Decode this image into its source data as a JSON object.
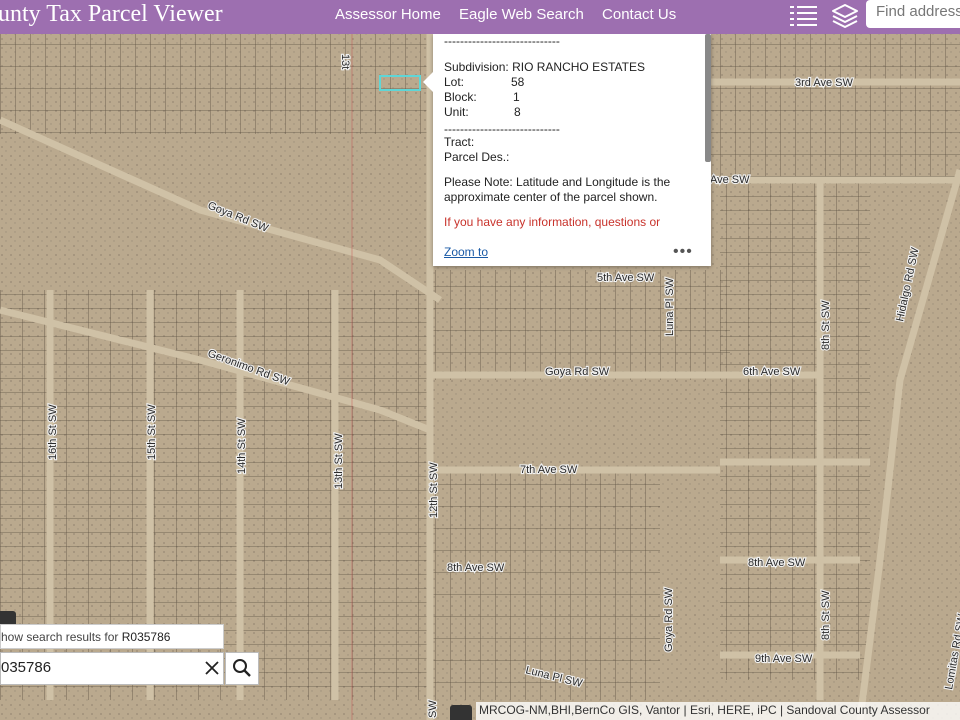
{
  "app": {
    "title": "unty Tax Parcel Viewer"
  },
  "nav": {
    "items": [
      "Assessor Home",
      "Eagle Web Search",
      "Contact Us"
    ]
  },
  "header": {
    "search_placeholder": "Find address",
    "menu_icon": "list-icon",
    "layers_icon": "layers-icon"
  },
  "popup": {
    "separator": "-----------------------------",
    "subdivision_label": "Subdivision:",
    "subdivision_value": "RIO RANCHO ESTATES",
    "lot_label": "Lot:",
    "lot_value": "58",
    "block_label": "Block:",
    "block_value": "1",
    "unit_label": "Unit:",
    "unit_value": "8",
    "tract_label": "Tract:",
    "parcel_label": "Parcel Des.:",
    "note": "Please Note: Latitude and Longitude is the approximate center of the parcel shown.",
    "info_text": "If you have any information, questions or",
    "zoom_label": "Zoom to",
    "more_label": "•••"
  },
  "search": {
    "results_prefix": "how search results for",
    "results_term": "R035786",
    "input_value": "035786",
    "clear_icon": "close-icon",
    "search_icon": "search-icon"
  },
  "attribution": {
    "text": "MRCOG-NM,BHI,BernCo GIS, Vantor | Esri, HERE, iPC | Sandoval County Assessor"
  },
  "streets": {
    "third_ave": "3rd Ave SW",
    "fourth_ave": "Ave SW",
    "fifth_ave": "5th Ave SW",
    "sixth_ave": "6th Ave SW",
    "seventh_ave": "7th Ave SW",
    "eighth_ave": "8th Ave SW",
    "eighth_ave_e": "8th Ave SW",
    "ninth_ave": "9th Ave SW",
    "goya_nw": "Goya Rd SW",
    "goya_mid": "Goya Rd SW",
    "goya_s": "Goya Rd SW",
    "geronimo": "Geronimo Rd SW",
    "luna_pl_n": "Luna Pl SW",
    "luna_pl_s": "Luna Pl SW",
    "st_16": "16th St SW",
    "st_15": "15th St SW",
    "st_14": "14th St SW",
    "st_13": "13th St SW",
    "st_13_top": "13t",
    "st_12": "12th St SW",
    "st_12_bottom": "SW",
    "st_8_n": "8th St SW",
    "st_8_s": "8th St SW",
    "hidalgo": "Hidalgo Rd SW",
    "corner": "Lomitas Rd SW"
  }
}
